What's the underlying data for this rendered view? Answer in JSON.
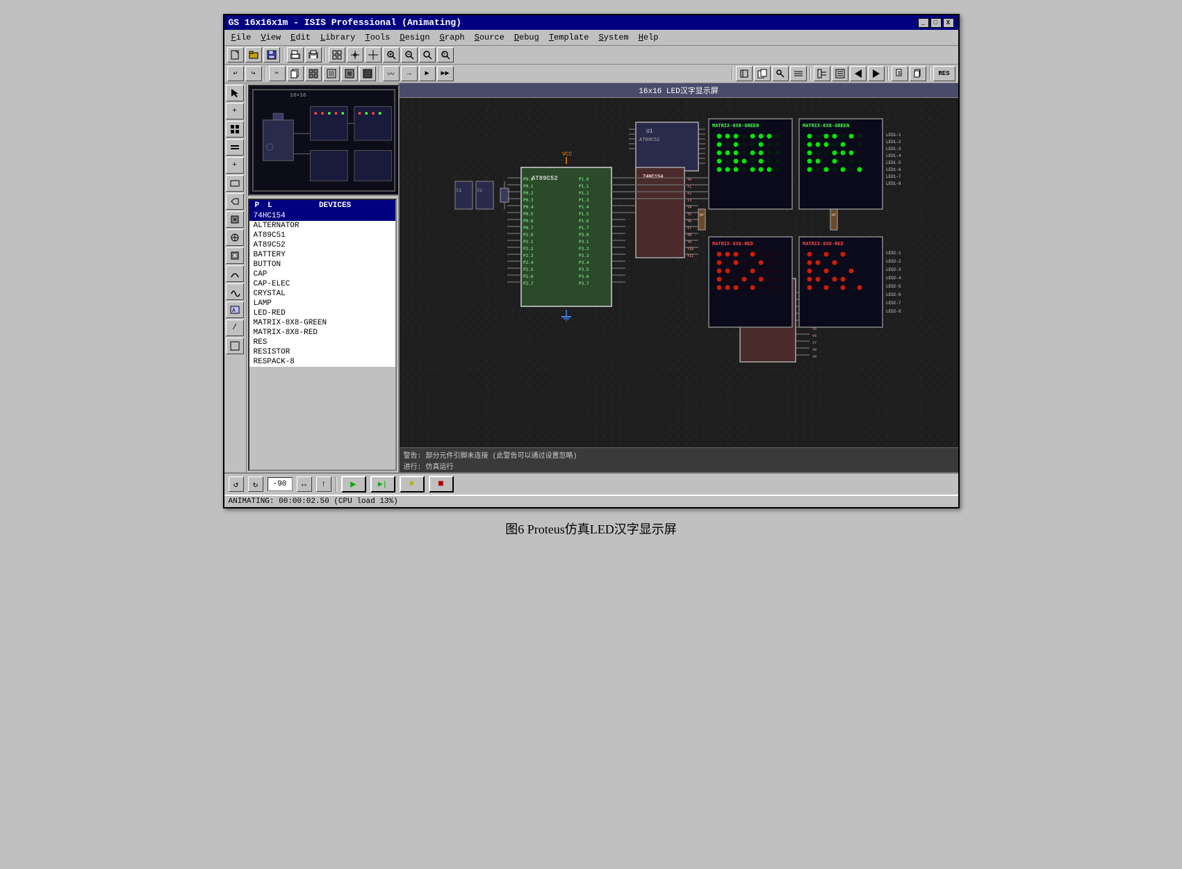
{
  "window": {
    "title": "GS 16x16x1m - ISIS Professional (Animating)",
    "minimize_label": "_",
    "maximize_label": "□",
    "close_label": "X"
  },
  "menu": {
    "items": [
      {
        "label": "File",
        "underline": "F"
      },
      {
        "label": "View",
        "underline": "V"
      },
      {
        "label": "Edit",
        "underline": "E"
      },
      {
        "label": "Library",
        "underline": "L"
      },
      {
        "label": "Tools",
        "underline": "T"
      },
      {
        "label": "Design",
        "underline": "D"
      },
      {
        "label": "Graph",
        "underline": "G"
      },
      {
        "label": "Source",
        "underline": "S"
      },
      {
        "label": "Debug",
        "underline": "D"
      },
      {
        "label": "Template",
        "underline": "T"
      },
      {
        "label": "System",
        "underline": "S"
      },
      {
        "label": "Help",
        "underline": "H"
      }
    ]
  },
  "toolbar": {
    "buttons": [
      "□",
      "📂",
      "■",
      "⊞",
      "🖨",
      "□",
      "⊞",
      "⊕",
      "✛",
      "🔍+",
      "🔍-",
      "🔍",
      "🔍"
    ]
  },
  "toolbar2": {
    "buttons": [
      "↩",
      "↪",
      "✂",
      "📋",
      "▦",
      "▦",
      "▦",
      "▦",
      "〰",
      "→",
      "▶",
      "▶"
    ]
  },
  "left_tools": {
    "tools": [
      "→",
      "+",
      "⊞",
      "≡",
      "+",
      "□",
      "▶",
      "⊠",
      "⊙",
      "⊠",
      "〰",
      "〰",
      "⊡",
      "/",
      "□"
    ]
  },
  "device_panel": {
    "header": {
      "p_label": "P",
      "l_label": "L",
      "devices_label": "DEVICES"
    },
    "devices": [
      {
        "name": "74HC154",
        "selected": true
      },
      {
        "name": "ALTERNATOR",
        "selected": false
      },
      {
        "name": "AT89C51",
        "selected": false
      },
      {
        "name": "AT89C52",
        "selected": false
      },
      {
        "name": "BATTERY",
        "selected": false
      },
      {
        "name": "BUTTON",
        "selected": false
      },
      {
        "name": "CAP",
        "selected": false
      },
      {
        "name": "CAP-ELEC",
        "selected": false
      },
      {
        "name": "CRYSTAL",
        "selected": false
      },
      {
        "name": "LAMP",
        "selected": false
      },
      {
        "name": "LED-RED",
        "selected": false
      },
      {
        "name": "MATRIX-8X8-GREEN",
        "selected": false
      },
      {
        "name": "MATRIX-8X8-RED",
        "selected": false
      },
      {
        "name": "RES",
        "selected": false
      },
      {
        "name": "RESISTOR",
        "selected": false
      },
      {
        "name": "RESPACK-8",
        "selected": false
      }
    ]
  },
  "canvas": {
    "title": "16x16 LED汉字显示屏",
    "status_line1": "警告: 部分元件引脚未连接 (此警告可以通过设置忽略)",
    "status_line2": "进行: 仿真运行"
  },
  "bottom_bar": {
    "rotate_ccw": "↺",
    "rotate_cw": "↻",
    "angle": "-90",
    "mirror_h": "↔",
    "mirror_v": "↑",
    "sim_play": "▶",
    "sim_step": "▶|",
    "sim_pause": "⏸",
    "sim_stop": "■"
  },
  "status_bar": {
    "text": "ANIMATING: 00:00:02.50 (CPU load 13%)"
  },
  "figure_caption": {
    "text": "图6  Proteus仿真LED汉字显示屏"
  }
}
